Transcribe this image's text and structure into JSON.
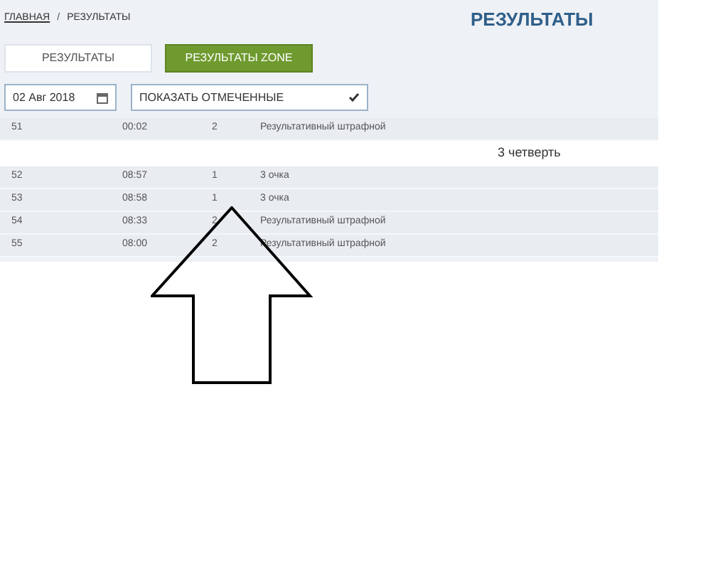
{
  "breadcrumb": [
    {
      "label": "ГЛАВНАЯ",
      "kind": "link"
    },
    {
      "label": "/",
      "kind": "separator"
    },
    {
      "label": "РЕЗУЛЬТАТЫ",
      "kind": "current"
    }
  ],
  "title": "РЕЗУЛЬТАТЫ",
  "tabs": [
    {
      "label": "РЕЗУЛЬТАТЫ",
      "selected": false
    },
    {
      "label": "РЕЗУЛЬТАТЫ ZONE",
      "selected": true
    }
  ],
  "date_field": {
    "value": "02 Авг 2018"
  },
  "filter_select": {
    "value": "ПОКАЗАТЬ ОТМЕЧЕННЫЕ"
  },
  "rows": [
    {
      "kind": "event",
      "cells": [
        "51",
        "00:02",
        "2",
        "Результативный штрафной"
      ]
    },
    {
      "kind": "period",
      "label": "3 четверть"
    },
    {
      "kind": "event",
      "cells": [
        "52",
        "08:57",
        "1",
        "3 очка"
      ]
    },
    {
      "kind": "event",
      "cells": [
        "53",
        "08:58",
        "1",
        "3 очка"
      ]
    },
    {
      "kind": "event",
      "cells": [
        "54",
        "08:33",
        "2",
        "Результативный штрафной"
      ]
    },
    {
      "kind": "event",
      "cells": [
        "55",
        "08:00",
        "2",
        "Результативный штрафной"
      ]
    }
  ]
}
